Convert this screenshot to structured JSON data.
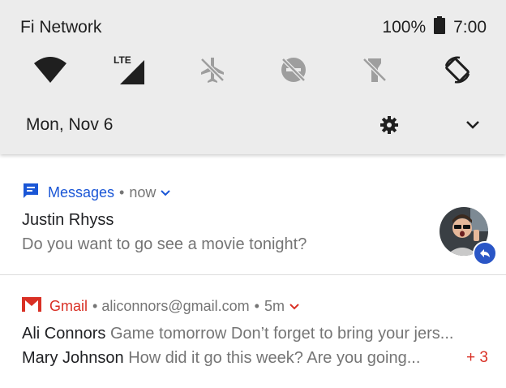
{
  "status_bar": {
    "carrier": "Fi Network",
    "battery": "100%",
    "time": "7:00"
  },
  "quick_settings": {
    "lte_label": "LTE",
    "tiles": [
      "wifi-icon",
      "lte-signal-icon",
      "airplane-mode-off-icon",
      "do-not-disturb-off-icon",
      "flashlight-off-icon",
      "auto-rotate-icon"
    ],
    "date": "Mon, Nov 6"
  },
  "notifications": [
    {
      "app": "Messages",
      "sep": "•",
      "time": "now",
      "title": "Justin Rhyss",
      "text": "Do you want to go see a movie tonight?",
      "accent": "#1a56d6"
    },
    {
      "app": "Gmail",
      "sep": "•",
      "account": "aliconnors@gmail.com",
      "sep2": "•",
      "time": "5m",
      "accent": "#d93025",
      "messages": [
        {
          "sender": "Ali Connors",
          "text": "Game tomorrow Don’t forget to bring your jers..."
        },
        {
          "sender": "Mary Johnson",
          "text": "How did it go this week? Are you going..."
        }
      ],
      "more_count": "+ 3"
    }
  ]
}
